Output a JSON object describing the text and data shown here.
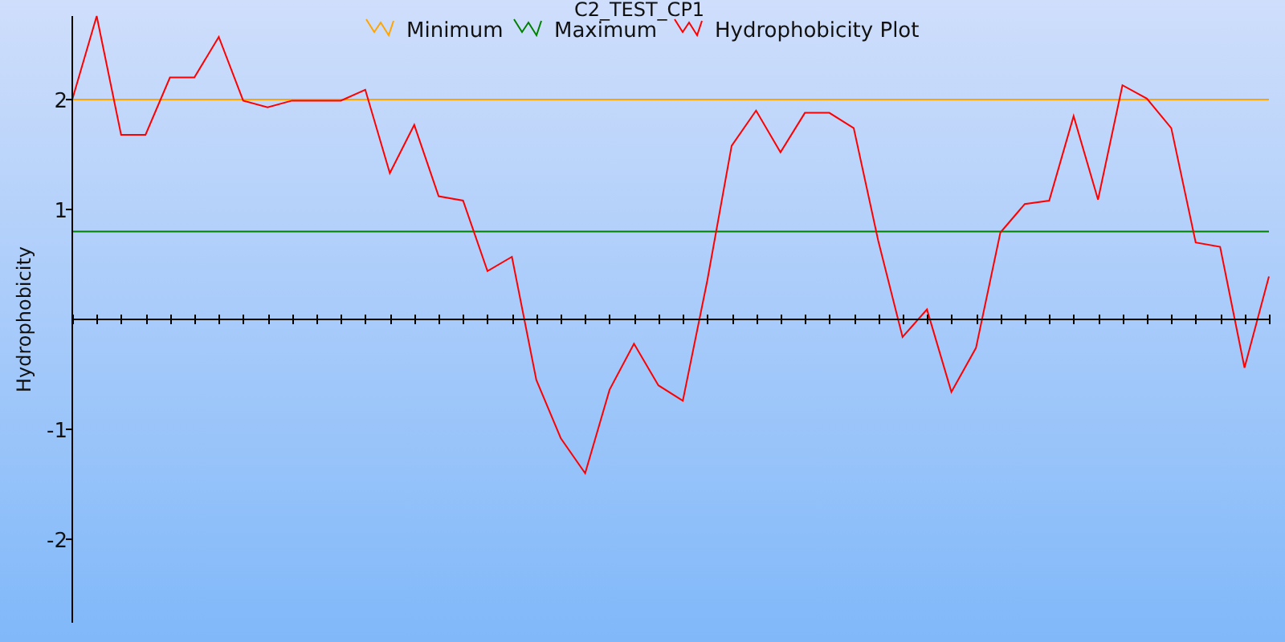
{
  "chart_data": {
    "type": "line",
    "title": "C2_TEST_CP1",
    "ylabel": "Hydrophobicity",
    "categories": [
      null,
      null,
      null,
      null,
      null,
      null,
      null,
      null,
      null,
      null,
      null,
      null,
      null,
      null,
      null,
      null,
      null,
      null,
      null,
      null,
      null,
      null,
      null,
      null,
      null,
      null,
      null,
      null,
      null,
      null,
      null,
      null,
      null,
      null,
      null,
      null,
      null,
      null,
      null,
      null,
      null,
      null,
      null,
      null,
      null,
      null,
      null,
      null,
      null,
      null
    ],
    "ylim": [
      -2.76,
      2.76
    ],
    "yticks": [
      -2,
      -1,
      1,
      2
    ],
    "legend": "top",
    "series": [
      {
        "name": "Minimum",
        "color": "#ffa500",
        "values": [
          2,
          2,
          2,
          2,
          2,
          2,
          2,
          2,
          2,
          2,
          2,
          2,
          2,
          2,
          2,
          2,
          2,
          2,
          2,
          2,
          2,
          2,
          2,
          2,
          2,
          2,
          2,
          2,
          2,
          2,
          2,
          2,
          2,
          2,
          2,
          2,
          2,
          2,
          2,
          2,
          2,
          2,
          2,
          2,
          2,
          2,
          2,
          2,
          2,
          2
        ]
      },
      {
        "name": "Maximum",
        "color": "#008000",
        "values": [
          0.8,
          0.8,
          0.8,
          0.8,
          0.8,
          0.8,
          0.8,
          0.8,
          0.8,
          0.8,
          0.8,
          0.8,
          0.8,
          0.8,
          0.8,
          0.8,
          0.8,
          0.8,
          0.8,
          0.8,
          0.8,
          0.8,
          0.8,
          0.8,
          0.8,
          0.8,
          0.8,
          0.8,
          0.8,
          0.8,
          0.8,
          0.8,
          0.8,
          0.8,
          0.8,
          0.8,
          0.8,
          0.8,
          0.8,
          0.8,
          0.8,
          0.8,
          0.8,
          0.8,
          0.8,
          0.8,
          0.8,
          0.8,
          0.8,
          0.8
        ]
      },
      {
        "name": "Hydrophobicity Plot",
        "color": "#ff0000",
        "values": [
          2.0,
          2.76,
          1.68,
          1.68,
          2.2,
          2.2,
          2.57,
          1.99,
          1.93,
          1.99,
          1.99,
          1.99,
          2.09,
          1.33,
          1.77,
          1.12,
          1.08,
          0.44,
          0.57,
          -0.55,
          -1.08,
          -1.4,
          -0.64,
          -0.22,
          -0.6,
          -0.74,
          0.35,
          1.58,
          1.9,
          1.52,
          1.88,
          1.88,
          1.74,
          0.72,
          -0.16,
          0.09,
          -0.66,
          -0.26,
          0.79,
          1.05,
          1.08,
          1.85,
          1.09,
          2.13,
          2.01,
          1.74,
          0.7,
          0.66,
          -0.44,
          0.39
        ]
      }
    ]
  }
}
